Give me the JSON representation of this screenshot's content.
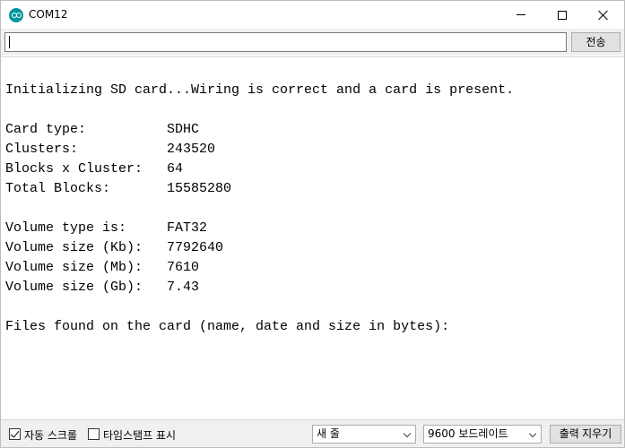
{
  "window": {
    "title": "COM12"
  },
  "input": {
    "value": "",
    "send_label": "전송"
  },
  "output": {
    "lines": [
      "Initializing SD card...Wiring is correct and a card is present.",
      "Card type:          SDHC",
      "Clusters:           243520",
      "Blocks x Cluster:   64",
      "Total Blocks:       15585280",
      "Volume type is:     FAT32",
      "Volume size (Kb):   7792640",
      "Volume size (Mb):   7610",
      "Volume size (Gb):   7.43",
      "Files found on the card (name, date and size in bytes):"
    ]
  },
  "footer": {
    "autoscroll": {
      "label": "자동 스크롤",
      "checked": true
    },
    "timestamp": {
      "label": "타임스탬프 표시",
      "checked": false
    },
    "line_ending": {
      "selected": "새 줄"
    },
    "baud": {
      "selected": "9600 보드레이트"
    },
    "clear_label": "출력 지우기"
  }
}
